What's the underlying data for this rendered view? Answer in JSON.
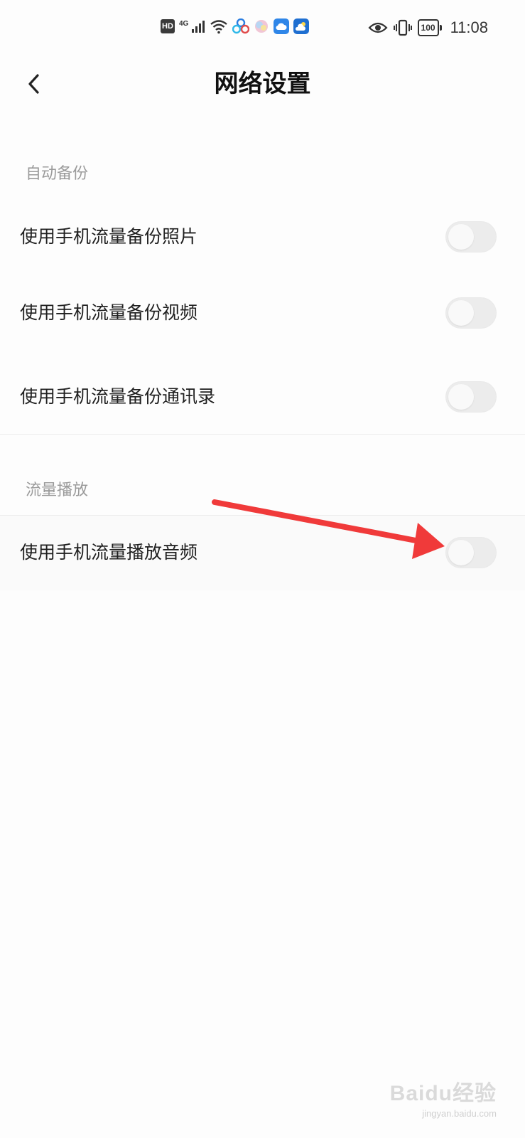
{
  "status_bar": {
    "hd_badge": "HD",
    "network_type": "4G",
    "battery_level": "100",
    "time": "11:08",
    "icons": [
      "hd-badge-icon",
      "signal-icon",
      "wifi-icon",
      "baidu-netdisk-icon",
      "color-ball-icon",
      "cloud-app-icon",
      "weather-app-icon",
      "eye-icon",
      "vibrate-icon",
      "battery-icon"
    ]
  },
  "header": {
    "title": "网络设置",
    "back_icon": "chevron-left-icon"
  },
  "sections": [
    {
      "title": "自动备份",
      "items": [
        {
          "label": "使用手机流量备份照片",
          "enabled": false
        },
        {
          "label": "使用手机流量备份视频",
          "enabled": false
        },
        {
          "label": "使用手机流量备份通讯录",
          "enabled": false
        }
      ]
    },
    {
      "title": "流量播放",
      "items": [
        {
          "label": "使用手机流量播放音频",
          "enabled": false
        }
      ]
    }
  ],
  "annotation": {
    "color": "#f03a3a"
  },
  "watermark": {
    "main": "Baidu经验",
    "sub": "jingyan.baidu.com"
  }
}
